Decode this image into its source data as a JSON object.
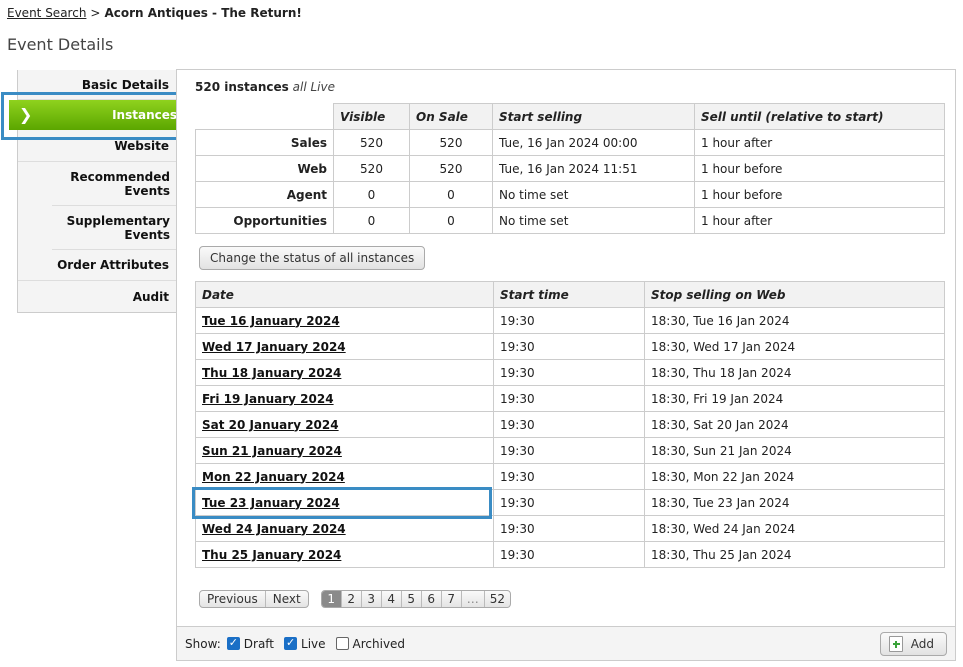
{
  "breadcrumb": {
    "link": "Event Search",
    "separator": ">",
    "current": "Acorn Antiques - The Return!"
  },
  "page_title": "Event Details",
  "sidebar": {
    "items": [
      {
        "label": "Basic Details"
      },
      {
        "label": "Instances",
        "active": true,
        "chevron": "❯"
      },
      {
        "label": "Website"
      },
      {
        "label": "Recommended Events"
      },
      {
        "label": "Supplementary Events"
      },
      {
        "label": "Order Attributes"
      },
      {
        "label": "Audit"
      }
    ]
  },
  "main": {
    "count_bold": "520 instances",
    "count_italic": "all Live",
    "summary": {
      "headers": [
        "Visible",
        "On Sale",
        "Start selling",
        "Sell until (relative to start)"
      ],
      "rows": [
        {
          "label": "Sales",
          "visible": "520",
          "on_sale": "520",
          "start": "Tue, 16 Jan 2024 00:00",
          "until": "1 hour after"
        },
        {
          "label": "Web",
          "visible": "520",
          "on_sale": "520",
          "start": "Tue, 16 Jan 2024 11:51",
          "until": "1 hour before"
        },
        {
          "label": "Agent",
          "visible": "0",
          "on_sale": "0",
          "start": "No time set",
          "until": "1 hour before"
        },
        {
          "label": "Opportunities",
          "visible": "0",
          "on_sale": "0",
          "start": "No time set",
          "until": "1 hour after"
        }
      ]
    },
    "change_status_label": "Change the status of all instances",
    "instances": {
      "headers": [
        "Date",
        "Start time",
        "Stop selling on Web"
      ],
      "rows": [
        {
          "date": "Tue 16 January 2024",
          "time": "19:30",
          "stop": "18:30, Tue 16 Jan 2024"
        },
        {
          "date": "Wed 17 January 2024",
          "time": "19:30",
          "stop": "18:30, Wed 17 Jan 2024"
        },
        {
          "date": "Thu 18 January 2024",
          "time": "19:30",
          "stop": "18:30, Thu 18 Jan 2024"
        },
        {
          "date": "Fri 19 January 2024",
          "time": "19:30",
          "stop": "18:30, Fri 19 Jan 2024"
        },
        {
          "date": "Sat 20 January 2024",
          "time": "19:30",
          "stop": "18:30, Sat 20 Jan 2024"
        },
        {
          "date": "Sun 21 January 2024",
          "time": "19:30",
          "stop": "18:30, Sun 21 Jan 2024"
        },
        {
          "date": "Mon 22 January 2024",
          "time": "19:30",
          "stop": "18:30, Mon 22 Jan 2024"
        },
        {
          "date": "Tue 23 January 2024",
          "time": "19:30",
          "stop": "18:30, Tue 23 Jan 2024"
        },
        {
          "date": "Wed 24 January 2024",
          "time": "19:30",
          "stop": "18:30, Wed 24 Jan 2024"
        },
        {
          "date": "Thu 25 January 2024",
          "time": "19:30",
          "stop": "18:30, Thu 25 Jan 2024"
        }
      ]
    },
    "pager": {
      "previous": "Previous",
      "next": "Next",
      "pages": [
        "1",
        "2",
        "3",
        "4",
        "5",
        "6",
        "7",
        "…",
        "52"
      ],
      "current": "1"
    },
    "footer": {
      "show_label": "Show:",
      "filters": [
        {
          "label": "Draft",
          "checked": true
        },
        {
          "label": "Live",
          "checked": true
        },
        {
          "label": "Archived",
          "checked": false
        }
      ],
      "add_label": "Add"
    }
  },
  "colors": {
    "active_tab": "#6cb80a",
    "highlight": "#3a8cc4",
    "checkbox": "#1a6fc6"
  }
}
